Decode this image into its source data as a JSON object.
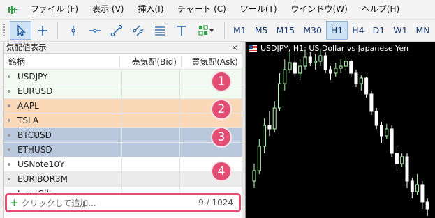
{
  "menu": {
    "items": [
      "ファイル (F)",
      "表示 (V)",
      "挿入(I)",
      "チャート (C)",
      "ツール(T)",
      "ウインドウ(W)",
      "ヘルプ(H)"
    ]
  },
  "toolbar": {
    "tools": [
      "cursor-icon",
      "crosshair-icon",
      "vertical-line-icon",
      "horizontal-line-icon",
      "trendline-icon",
      "channel-icon",
      "fibonacci-icon",
      "text-icon",
      "shapes-icon"
    ],
    "timeframes": [
      "M1",
      "M5",
      "M15",
      "M30",
      "H1",
      "H4",
      "D1",
      "W1",
      "MN"
    ],
    "active_timeframe": "H1"
  },
  "market_watch": {
    "title": "気配値表示",
    "close": "×",
    "columns": {
      "symbol": "銘柄",
      "bid": "売気配(Bid)",
      "ask": "買気配(Ask)"
    },
    "rows": [
      {
        "symbol": "USDJPY"
      },
      {
        "symbol": "EURUSD"
      },
      {
        "symbol": "AAPL"
      },
      {
        "symbol": "TSLA"
      },
      {
        "symbol": "BTCUSD"
      },
      {
        "symbol": "ETHUSD"
      },
      {
        "symbol": "USNote10Y"
      },
      {
        "symbol": "EURIBOR3M"
      },
      {
        "symbol": "LongGilt"
      }
    ],
    "badges": [
      "1",
      "2",
      "3",
      "4"
    ],
    "add_symbol": {
      "plus": "+",
      "placeholder": "クリックして追加...",
      "count": "9 / 1024"
    }
  },
  "chart": {
    "title": "USDJPY, H1:  US Dollar vs Japanese Yen",
    "bull_color": "#b6ffb6",
    "bear_color": "#ffffff"
  }
}
